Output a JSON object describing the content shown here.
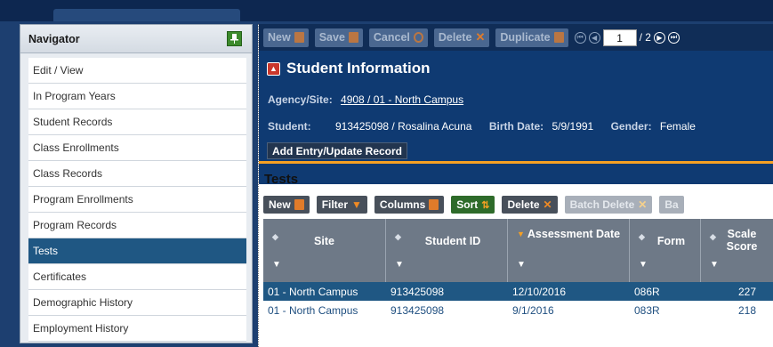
{
  "navigator": {
    "title": "Navigator",
    "items": [
      {
        "label": "Edit / View"
      },
      {
        "label": "In Program Years"
      },
      {
        "label": "Student Records"
      },
      {
        "label": "Class Enrollments"
      },
      {
        "label": "Class Records"
      },
      {
        "label": "Program Enrollments"
      },
      {
        "label": "Program Records"
      },
      {
        "label": "Tests"
      },
      {
        "label": "Certificates"
      },
      {
        "label": "Demographic History"
      },
      {
        "label": "Employment History"
      }
    ],
    "active_item": "Tests"
  },
  "toolbar": {
    "new_label": "New",
    "save_label": "Save",
    "cancel_label": "Cancel",
    "delete_label": "Delete",
    "duplicate_label": "Duplicate",
    "page_value": "1",
    "page_total": "/ 2"
  },
  "student_info": {
    "title": "Student Information",
    "agency_label": "Agency/Site:",
    "agency_value": "4908 / 01 - North Campus",
    "student_label": "Student:",
    "student_value": "913425098 / Rosalina Acuna",
    "birth_label": "Birth Date:",
    "birth_value": "5/9/1991",
    "gender_label": "Gender:",
    "gender_value": "Female",
    "add_button": "Add Entry/Update Record"
  },
  "tests": {
    "title": "Tests",
    "buttons": {
      "new": "New",
      "filter": "Filter",
      "columns": "Columns",
      "sort": "Sort",
      "delete": "Delete",
      "batch_delete": "Batch Delete",
      "batch_cut": "Ba"
    },
    "columns": [
      "Site",
      "Student ID",
      "Assessment Date",
      "Form",
      "Scale Score"
    ],
    "rows": [
      [
        "01 - North Campus",
        "913425098",
        "12/10/2016",
        "086R",
        "227"
      ],
      [
        "01 - North Campus",
        "913425098",
        "9/1/2016",
        "083R",
        "218"
      ]
    ]
  },
  "colors": {
    "frame": "#1d3f70",
    "accent_orange": "#f6a023",
    "selected_row": "#1f5783",
    "sort_green": "#2e6b2a"
  }
}
